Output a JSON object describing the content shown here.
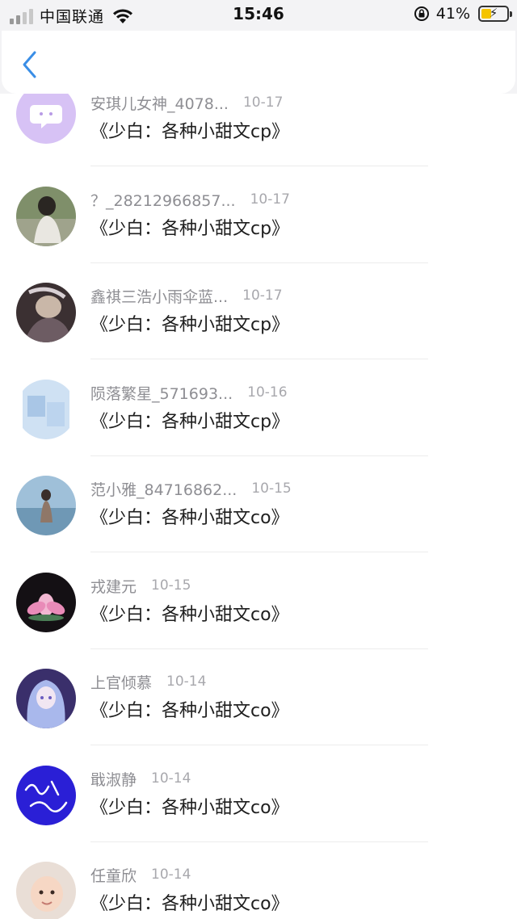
{
  "status_bar": {
    "carrier": "中国联通",
    "time": "15:46",
    "battery": "41%",
    "battery_level": 0.41
  },
  "nav": {
    "back_icon": "chevron-left-icon",
    "accent": "#3a8ee6"
  },
  "rows": [
    {
      "name": "安琪儿女神_4078...",
      "date": "10-17",
      "title": "《少白：各种小甜文cp》",
      "avatar": "chat-bubble-avatar"
    },
    {
      "name": "？_28212966857...",
      "date": "10-17",
      "title": "《少白：各种小甜文cp》",
      "avatar": "photo-avatar"
    },
    {
      "name": "鑫祺三浩小雨伞蓝...",
      "date": "10-17",
      "title": "《少白：各种小甜文cp》",
      "avatar": "photo-avatar"
    },
    {
      "name": "陨落繁星_571693...",
      "date": "10-16",
      "title": "《少白：各种小甜文cp》",
      "avatar": "photo-avatar"
    },
    {
      "name": "范小雅_84716862...",
      "date": "10-15",
      "title": "《少白：各种小甜文co》",
      "avatar": "photo-avatar"
    },
    {
      "name": "戎建元",
      "date": "10-15",
      "title": "《少白：各种小甜文co》",
      "avatar": "lotus-avatar"
    },
    {
      "name": "上官倾慕",
      "date": "10-14",
      "title": "《少白：各种小甜文co》",
      "avatar": "anime-avatar"
    },
    {
      "name": "戢淑静",
      "date": "10-14",
      "title": "《少白：各种小甜文co》",
      "avatar": "handwriting-avatar"
    },
    {
      "name": "任童欣",
      "date": "10-14",
      "title": "《少白：各种小甜文co》",
      "avatar": "baby-avatar"
    }
  ]
}
